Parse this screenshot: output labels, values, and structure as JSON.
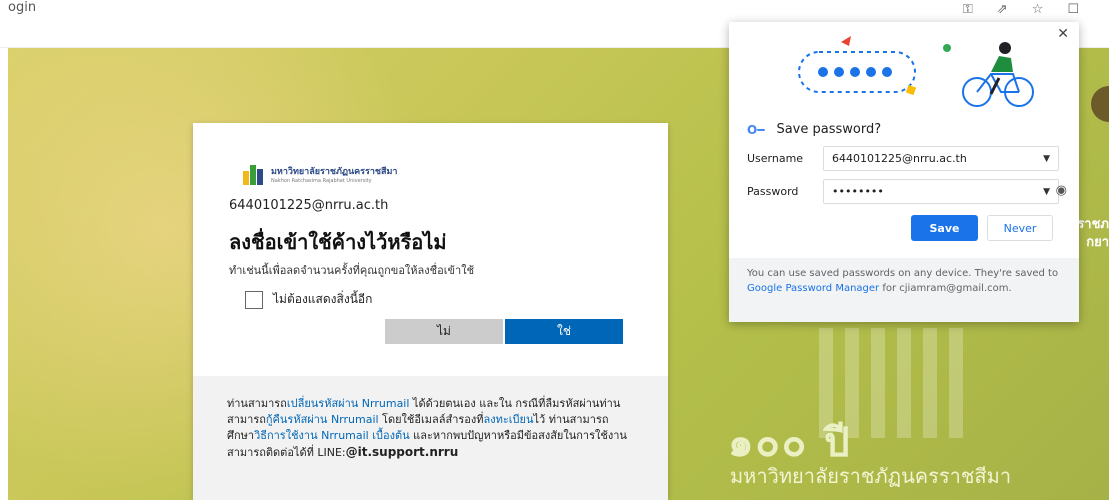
{
  "browser": {
    "tab_title": "ogin",
    "icons": [
      "key-icon",
      "share-icon",
      "star-icon",
      "window-icon"
    ]
  },
  "background": {
    "side_text_1": "ราชภ",
    "side_text_2": "กยา",
    "big_number": "๑๐๐ ปี",
    "university_name": "มหาวิทยาลัยราชภัฏนครราชสีมา"
  },
  "login": {
    "logo_th": "มหาวิทยาลัยราชภัฏนครราชสีมา",
    "logo_en": "Nakhon Ratchasima Rajabhat University",
    "email": "6440101225@nrru.ac.th",
    "title": "ลงชื่อเข้าใช้ค้างไว้หรือไม่",
    "description": "ทำเช่นนี้เพื่อลดจำนวนครั้งที่คุณถูกขอให้ลงชื่อเข้าใช้",
    "checkbox_label": "ไม่ต้องแสดงสิ่งนี้อีก",
    "no_label": "ไม่",
    "yes_label": "ใช่",
    "footer": {
      "p1": "ท่านสามารถ",
      "link1": "เปลี่ยนรหัสผ่าน Nrrumail",
      "p2": " ได้ด้วยตนเอง และใน กรณีที่ลืมรหัสผ่านท่านสามารถ",
      "link2": "กู้คืนรหัสผ่าน Nrrumail",
      "p3": " โดยใช้อีเมลล์สำรองที่",
      "link3": "ลงทะเบียน",
      "p4": "ไว้ ท่านสามารถศึกษา",
      "link4": "วิธีการใช้งาน Nrrumail เบื้องต้น",
      "p5": " และหากพบปัญหาหรือมีข้อสงสัยในการใช้งานสามารถติดต่อได้ที่ LINE:",
      "line_id": "@it.support.nrru"
    }
  },
  "save_password": {
    "title": "Save password?",
    "username_label": "Username",
    "username_value": "6440101225@nrru.ac.th",
    "password_label": "Password",
    "password_value": "••••••••",
    "save_label": "Save",
    "never_label": "Never",
    "note_p1": "You can use saved passwords on any device. They're saved to ",
    "note_link": "Google Password Manager",
    "note_p2": " for cjiamram@gmail.com.",
    "colors": {
      "primary": "#1a73e8",
      "note_bg": "#f1f3f4"
    }
  }
}
